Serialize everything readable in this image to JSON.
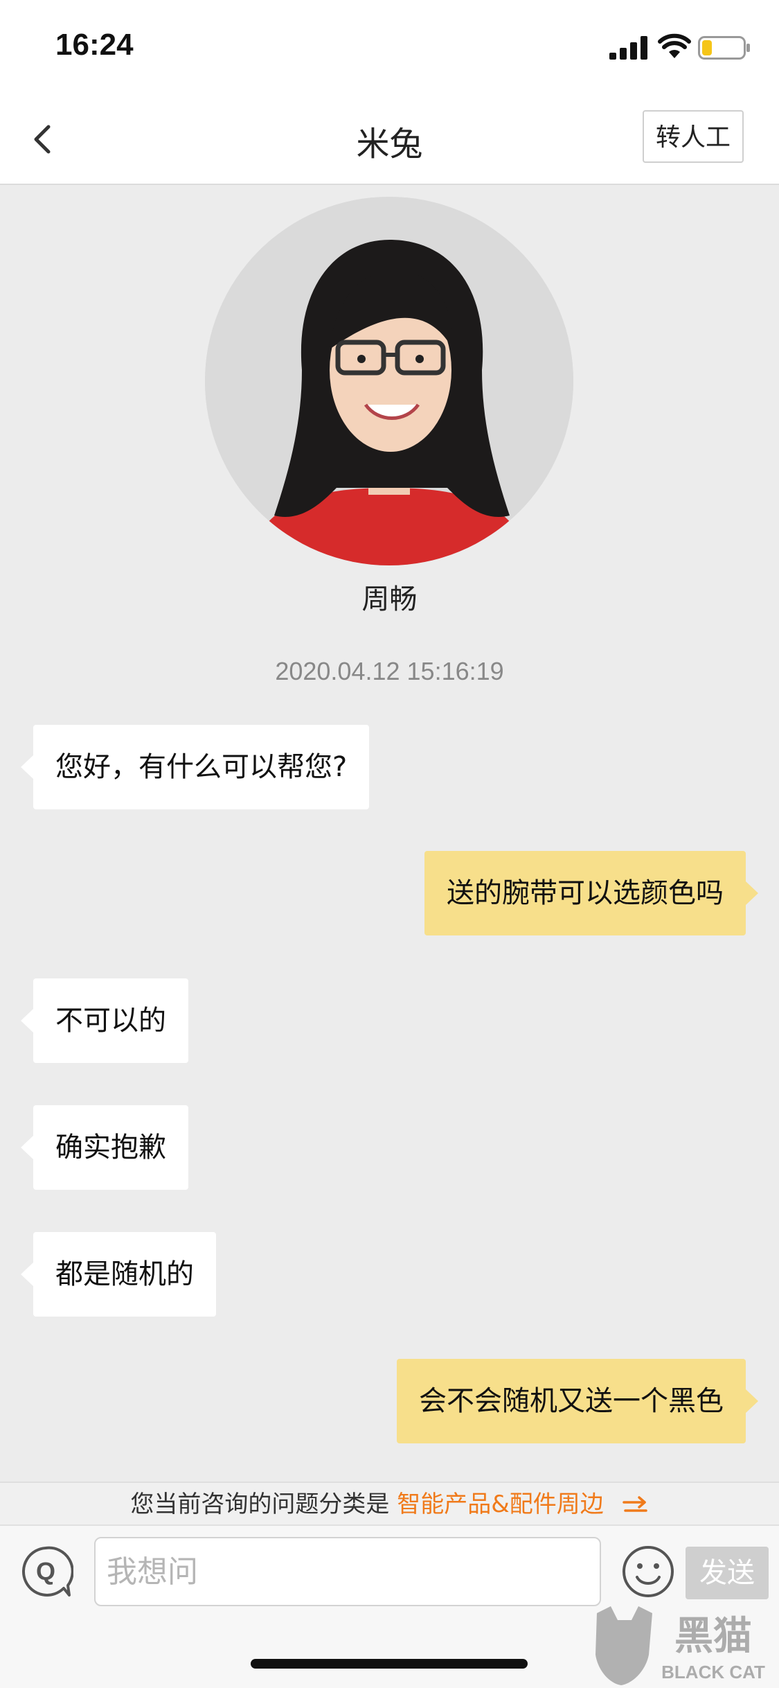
{
  "status_bar": {
    "time": "16:24",
    "battery_color": "#f5c518"
  },
  "nav": {
    "title": "米兔",
    "transfer_label": "转人工"
  },
  "agent": {
    "name": "周畅"
  },
  "chat": {
    "timestamp": "2020.04.12 15:16:19",
    "messages": [
      {
        "side": "left",
        "text": "您好，有什么可以帮您?"
      },
      {
        "side": "right",
        "text": "送的腕带可以选颜色吗"
      },
      {
        "side": "left",
        "text": "不可以的"
      },
      {
        "side": "left",
        "text": "确实抱歉"
      },
      {
        "side": "left",
        "text": "都是随机的"
      },
      {
        "side": "right",
        "text": "会不会随机又送一个黑色"
      }
    ]
  },
  "category": {
    "prefix": "您当前咨询的问题分类是",
    "value": "智能产品&配件周边"
  },
  "input": {
    "placeholder": "我想问",
    "send_label": "发送"
  },
  "watermark": {
    "text_cn": "黑猫",
    "text_en": "BLACK CAT"
  },
  "colors": {
    "user_bubble": "#f7df8b",
    "agent_bubble": "#ffffff",
    "accent": "#f07a1a"
  }
}
